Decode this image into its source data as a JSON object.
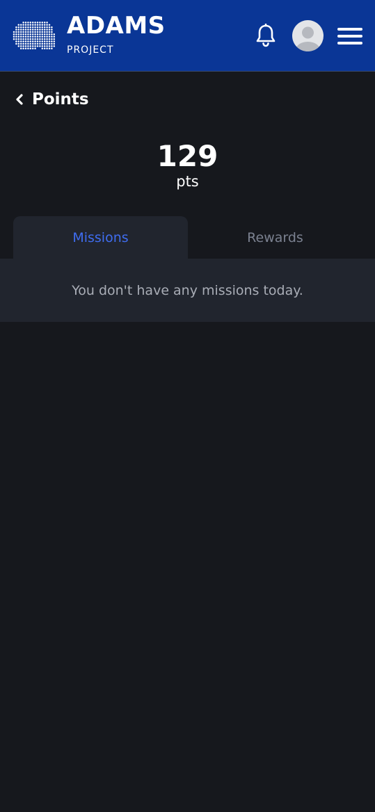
{
  "header": {
    "brand_title": "ADAMS",
    "brand_subtitle": "PROJECT",
    "icons": [
      "dotted-cloud-logo-icon",
      "bell-icon",
      "user-avatar-icon",
      "hamburger-menu-icon"
    ]
  },
  "page": {
    "back_label": "Points",
    "back_icon": "chevron-left-icon"
  },
  "points": {
    "value": "129",
    "unit": "pts"
  },
  "tabs": [
    {
      "label": "Missions",
      "active": true
    },
    {
      "label": "Rewards",
      "active": false
    }
  ],
  "missions": {
    "empty_message": "You don't have any missions today."
  },
  "colors": {
    "header_bg": "#0a3696",
    "page_bg": "#16181d",
    "panel_bg": "#21252e",
    "active_tab": "#3f6df0",
    "inactive_tab": "#7b8190"
  }
}
